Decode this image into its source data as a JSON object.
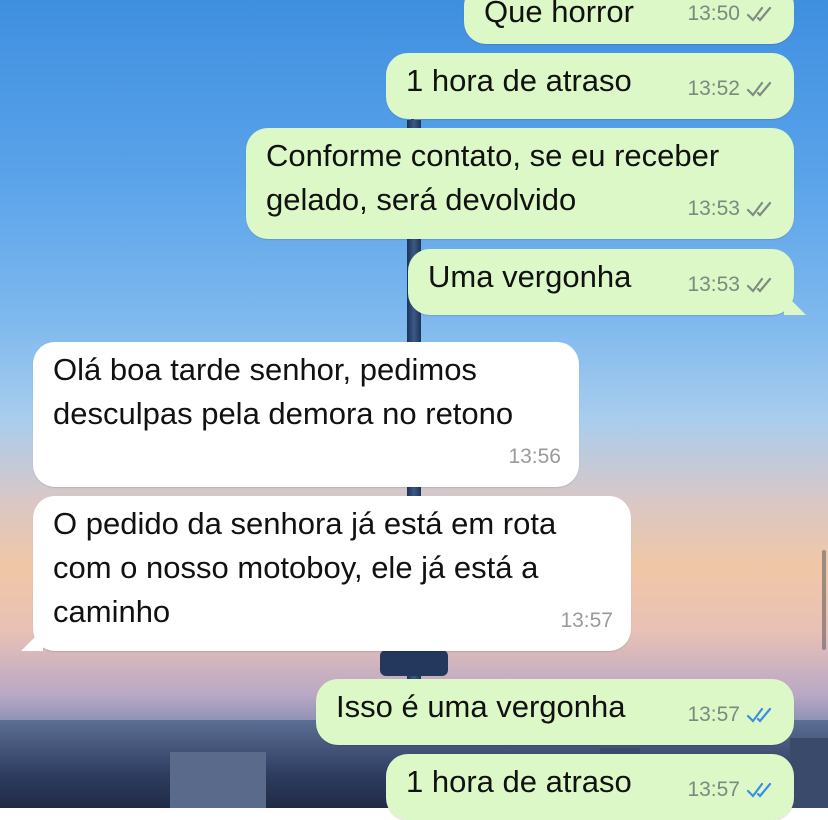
{
  "messages": [
    {
      "text": "Que horror",
      "time": "13:50",
      "ticks": "read-grey"
    },
    {
      "text": "1 hora de atraso",
      "time": "13:52",
      "ticks": "read-grey"
    },
    {
      "text": "Conforme contato, se eu receber\ngelado, será devolvido",
      "time": "13:53",
      "ticks": "read-grey"
    },
    {
      "text": "Uma vergonha",
      "time": "13:53",
      "ticks": "read-grey"
    },
    {
      "text": "Olá boa tarde senhor, pedimos\ndesculpas pela demora no retono",
      "time": "13:56"
    },
    {
      "text": "O pedido da senhora já está em rota\ncom o nosso motoboy, ele já está a\ncaminho",
      "time": "13:57"
    },
    {
      "text": "Isso é uma vergonha",
      "time": "13:57",
      "ticks": "read-blue"
    },
    {
      "text": "1 hora de atraso",
      "time": "13:57",
      "ticks": "read-blue"
    }
  ],
  "colors": {
    "outgoing_bubble": "#dcf8c6",
    "incoming_bubble": "#ffffff",
    "tick_grey": "#7f8b83",
    "tick_blue": "#3a8ee6"
  }
}
